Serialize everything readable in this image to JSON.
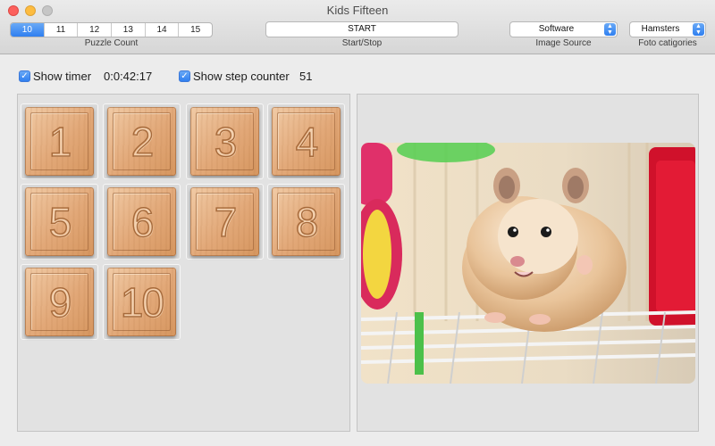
{
  "window": {
    "title": "Kids Fifteen"
  },
  "toolbar": {
    "puzzle_counts": [
      "10",
      "11",
      "12",
      "13",
      "14",
      "15"
    ],
    "puzzle_count_selected": "10",
    "puzzle_count_label": "Puzzle Count",
    "start_button": "START",
    "start_stop_label": "Start/Stop",
    "image_source_value": "Software",
    "image_source_label": "Image Source",
    "foto_category_value": "Hamsters",
    "foto_category_label": "Foto catigories"
  },
  "options": {
    "show_timer_label": "Show timer",
    "timer_value": "0:0:42:17",
    "show_timer_checked": true,
    "show_step_counter_label": "Show step counter",
    "step_counter_value": "51",
    "show_step_counter_checked": true
  },
  "board": {
    "tiles": [
      "1",
      "2",
      "3",
      "4",
      "5",
      "6",
      "7",
      "8",
      "9",
      "10"
    ]
  },
  "colors": {
    "accent": "#2f7ff0",
    "tile_wood": "#e2a878"
  }
}
